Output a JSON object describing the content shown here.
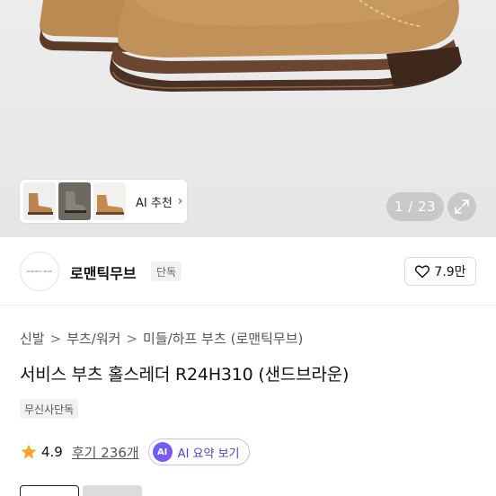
{
  "gallery": {
    "ai_recommend_label": "AI 추천",
    "image_counter": "1 / 23",
    "thumbnails": [
      "boot-tan-thumb",
      "boot-pair-gray-thumb",
      "boot-tan-side-thumb"
    ]
  },
  "brand": {
    "logo_text": "ROMANTIC MOVE",
    "name": "로맨틱무브",
    "badge": "단독",
    "like_count": "7.9만"
  },
  "breadcrumb": {
    "items": [
      "신발",
      "부츠/워커",
      "미들/하프 부츠",
      "(로맨틱무브)"
    ],
    "separator": ">"
  },
  "product": {
    "title": "서비스 부츠 홀스레더 R24H310 (샌드브라운)",
    "tag": "무신사단독",
    "rating": "4.9",
    "reviews_label": "후기 236개",
    "ai_summary_badge": "AI",
    "ai_summary_label": "AI 요약 보기"
  },
  "colors": {
    "accent_purple": "#4a3fd0",
    "star": "#f5a623",
    "boot_suede": "#c09158",
    "sole": "#5a3d2b"
  }
}
